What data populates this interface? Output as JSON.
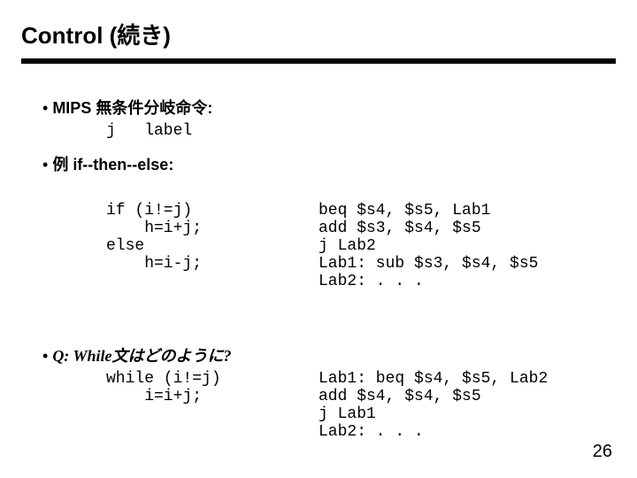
{
  "title": "Control (続き)",
  "bullet1_prefix": "MIPS ",
  "bullet1_bold": "無条件分岐命令:",
  "jline": "j   label",
  "bullet2": "例   if--then--else:",
  "code_if": "if (i!=j)\n    h=i+j;\nelse\n    h=i-j;",
  "code_if_asm": "beq $s4, $s5, Lab1\nadd $s3, $s4, $s5\nj Lab2\nLab1: sub $s3, $s4, $s5\nLab2: . . .",
  "bullet3": "Q: While文はどのように?",
  "code_while": "while (i!=j)\n    i=i+j;",
  "code_while_asm": "Lab1: beq $s4, $s5, Lab2\nadd $s4, $s4, $s5\nj Lab1\nLab2: . . .",
  "pagenum": "26"
}
